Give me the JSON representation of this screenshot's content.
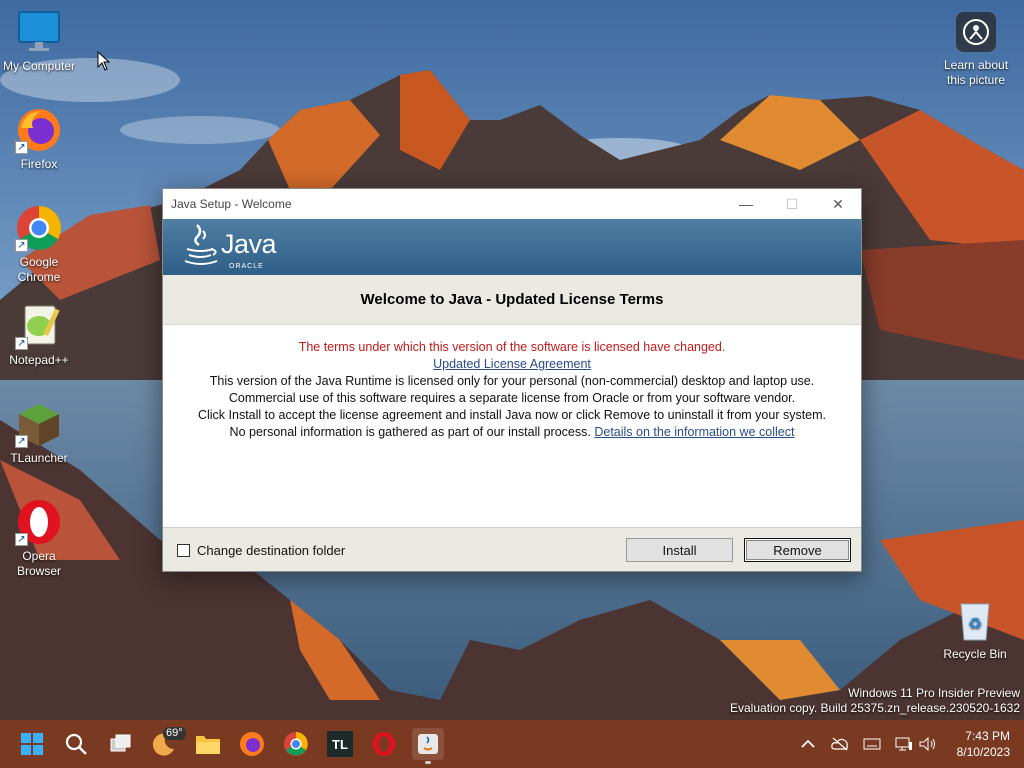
{
  "desktop": {
    "icons": [
      {
        "label": "My Computer"
      },
      {
        "label": "Firefox"
      },
      {
        "label": "Google Chrome"
      },
      {
        "label": "Notepad++"
      },
      {
        "label": "TLauncher"
      },
      {
        "label": "Opera Browser"
      },
      {
        "label": "Recycle Bin"
      }
    ],
    "learn_label": "Learn about this picture",
    "watermark_line1": "Windows 11 Pro Insider Preview",
    "watermark_line2": "Evaluation copy. Build 25375.zn_release.230520-1632"
  },
  "dialog": {
    "title": "Java Setup - Welcome",
    "logo_text": "Java",
    "logo_sub": "ORACLE",
    "heading": "Welcome to Java - Updated License Terms",
    "notice": "The terms under which this version of the software is licensed have changed.",
    "agreement_link": "Updated License Agreement",
    "para1": "This version of the Java Runtime is licensed only for your personal (non-commercial) desktop and laptop use.",
    "para2": "Commercial use of this software requires a separate license from Oracle or from your software vendor.",
    "para3": "Click Install to accept the license agreement and install Java now or click Remove to uninstall it from your system.",
    "para4": "No personal information is gathered as part of our install process.",
    "details_link": "Details on the information we collect",
    "checkbox_label": "Change destination folder",
    "checkbox_checked": false,
    "install_label": "Install",
    "remove_label": "Remove"
  },
  "taskbar": {
    "weather_temp": "69°",
    "time": "7:43 PM",
    "date": "8/10/2023",
    "tl_label": "TL"
  },
  "colors": {
    "taskbar": "#7a3a22",
    "banner": "#3c6c94",
    "notice_red": "#c01a1a",
    "link_blue": "#2a4c8a"
  }
}
